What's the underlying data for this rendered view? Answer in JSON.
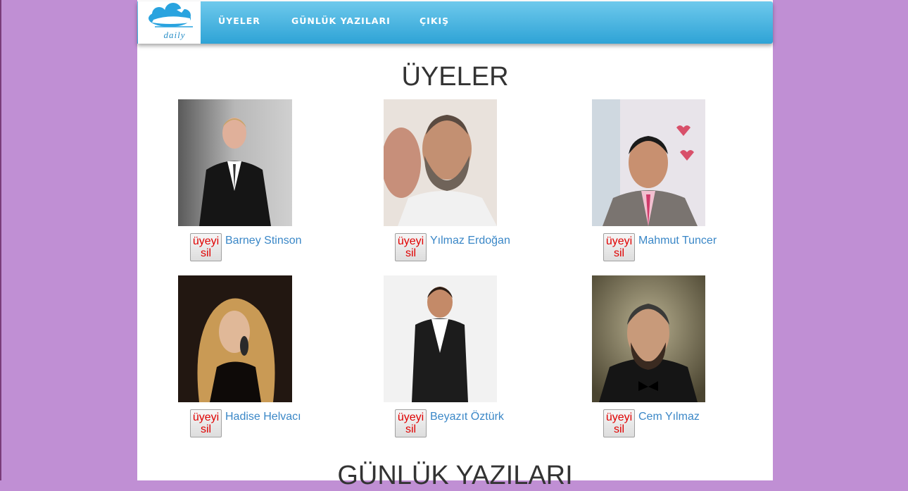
{
  "brand": {
    "logo_text": "daily"
  },
  "nav": [
    {
      "label": "ÜYELER"
    },
    {
      "label": "GÜNLÜK YAZILARI"
    },
    {
      "label": "ÇIKIŞ"
    }
  ],
  "members_section": {
    "title": "ÜYELER"
  },
  "delete_button": {
    "line1": "üyeyi",
    "line2": "sil"
  },
  "members": [
    {
      "name": "Barney Stinson"
    },
    {
      "name": "Yılmaz Erdoğan"
    },
    {
      "name": "Mahmut Tuncer"
    },
    {
      "name": "Hadise Helvacı"
    },
    {
      "name": "Beyazıt Öztürk"
    },
    {
      "name": "Cem Yılmaz"
    }
  ],
  "posts_section": {
    "title": "GÜNLÜK YAZILARI"
  },
  "colors": {
    "page_background": "#c08fd4",
    "navbar_top": "#6ec9ec",
    "navbar_bottom": "#2ea3d6",
    "link": "#3a87c7",
    "delete_text": "#e00000"
  }
}
